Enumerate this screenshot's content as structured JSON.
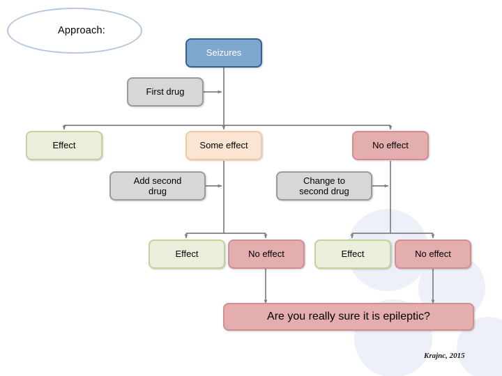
{
  "slide": {
    "title_shape": {
      "label": "Approach:",
      "shape": "ellipse",
      "border_color": "#b7c7dd"
    },
    "citation": "Krajnc, 2015",
    "background_color": "#ffffff",
    "accent_colors": {
      "blue_fill": "#7fa6cf",
      "blue_border": "#36608f",
      "gray_fill": "#d7d7d7",
      "gray_border": "#9a9a9a",
      "green_fill": "#e9efdb",
      "green_border": "#c3d29a",
      "peach_fill": "#fbe5d2",
      "peach_border": "#f0c9a6",
      "pink_fill": "#e4aeaf",
      "pink_border": "#cf8e90",
      "connector": "#7f7f7f",
      "bg_blob": "#edf0f9"
    }
  },
  "nodes": {
    "seizures": {
      "label": "Seizures",
      "style": "blue"
    },
    "first_drug": {
      "label": "First drug",
      "style": "gray"
    },
    "effect_l1": {
      "label": "Effect",
      "style": "green"
    },
    "some_effect": {
      "label": "Some effect",
      "style": "peach"
    },
    "no_effect_l1": {
      "label": "No effect",
      "style": "pink"
    },
    "add_second_drug": {
      "label": "Add second\ndrug",
      "style": "gray"
    },
    "change_second_drug": {
      "label": "Change to\nsecond drug",
      "style": "gray"
    },
    "effect_l2_left": {
      "label": "Effect",
      "style": "green"
    },
    "no_effect_l2_left": {
      "label": "No effect",
      "style": "pink"
    },
    "effect_l2_right": {
      "label": "Effect",
      "style": "green"
    },
    "no_effect_l2_right": {
      "label": "No effect",
      "style": "pink"
    },
    "final_question": {
      "label": "Are you really sure it is epileptic?",
      "style": "pink"
    }
  },
  "flow": {
    "edges": [
      {
        "from": "seizures",
        "to": "branch_level_1"
      },
      {
        "from": "first_drug",
        "to": "seizures_trunk"
      },
      {
        "from": "branch_level_1",
        "to": "effect_l1"
      },
      {
        "from": "branch_level_1",
        "to": "some_effect"
      },
      {
        "from": "branch_level_1",
        "to": "no_effect_l1"
      },
      {
        "from": "some_effect",
        "to": "branch_level_2_left"
      },
      {
        "from": "add_second_drug",
        "to": "some_effect_trunk"
      },
      {
        "from": "branch_level_2_left",
        "to": "effect_l2_left"
      },
      {
        "from": "branch_level_2_left",
        "to": "no_effect_l2_left"
      },
      {
        "from": "no_effect_l1",
        "to": "branch_level_2_right"
      },
      {
        "from": "change_second_drug",
        "to": "no_effect_trunk"
      },
      {
        "from": "branch_level_2_right",
        "to": "effect_l2_right"
      },
      {
        "from": "branch_level_2_right",
        "to": "no_effect_l2_right"
      },
      {
        "from": "no_effect_l2_left",
        "to": "final_question"
      },
      {
        "from": "no_effect_l2_right",
        "to": "final_question"
      }
    ]
  }
}
